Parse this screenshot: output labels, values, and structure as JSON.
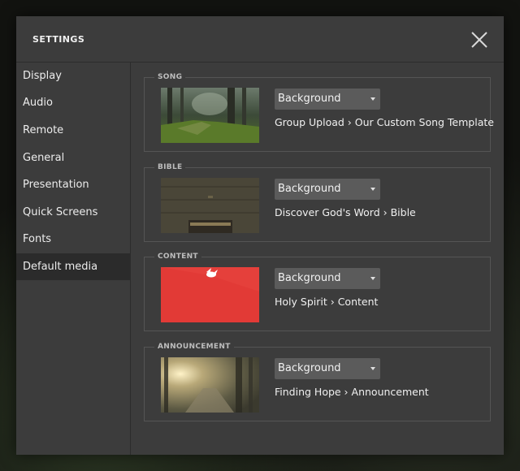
{
  "dialog": {
    "title": "SETTINGS",
    "close_icon": "close-icon"
  },
  "sidebar": {
    "items": [
      {
        "label": "Display",
        "active": false
      },
      {
        "label": "Audio",
        "active": false
      },
      {
        "label": "Remote",
        "active": false
      },
      {
        "label": "General",
        "active": false
      },
      {
        "label": "Presentation",
        "active": false
      },
      {
        "label": "Quick Screens",
        "active": false
      },
      {
        "label": "Fonts",
        "active": false
      },
      {
        "label": "Default media",
        "active": true
      }
    ]
  },
  "sections": [
    {
      "label": "SONG",
      "select_value": "Background",
      "media_path": "Group Upload › Our Custom Song Template",
      "thumbnail": "forest-path-thumbnail"
    },
    {
      "label": "BIBLE",
      "select_value": "Background",
      "media_path": "Discover God's Word › Bible",
      "thumbnail": "bible-on-wood-thumbnail"
    },
    {
      "label": "CONTENT",
      "select_value": "Background",
      "media_path": "Holy Spirit › Content",
      "thumbnail": "red-dove-thumbnail"
    },
    {
      "label": "ANNOUNCEMENT",
      "select_value": "Background",
      "media_path": "Finding Hope › Announcement",
      "thumbnail": "sunlit-forest-road-thumbnail"
    }
  ],
  "colors": {
    "dialog_bg": "#3c3c3c",
    "sidebar_active_bg": "#2b2b2b",
    "select_bg": "#5b5b5b",
    "content_thumb_red": "#e23a36"
  }
}
